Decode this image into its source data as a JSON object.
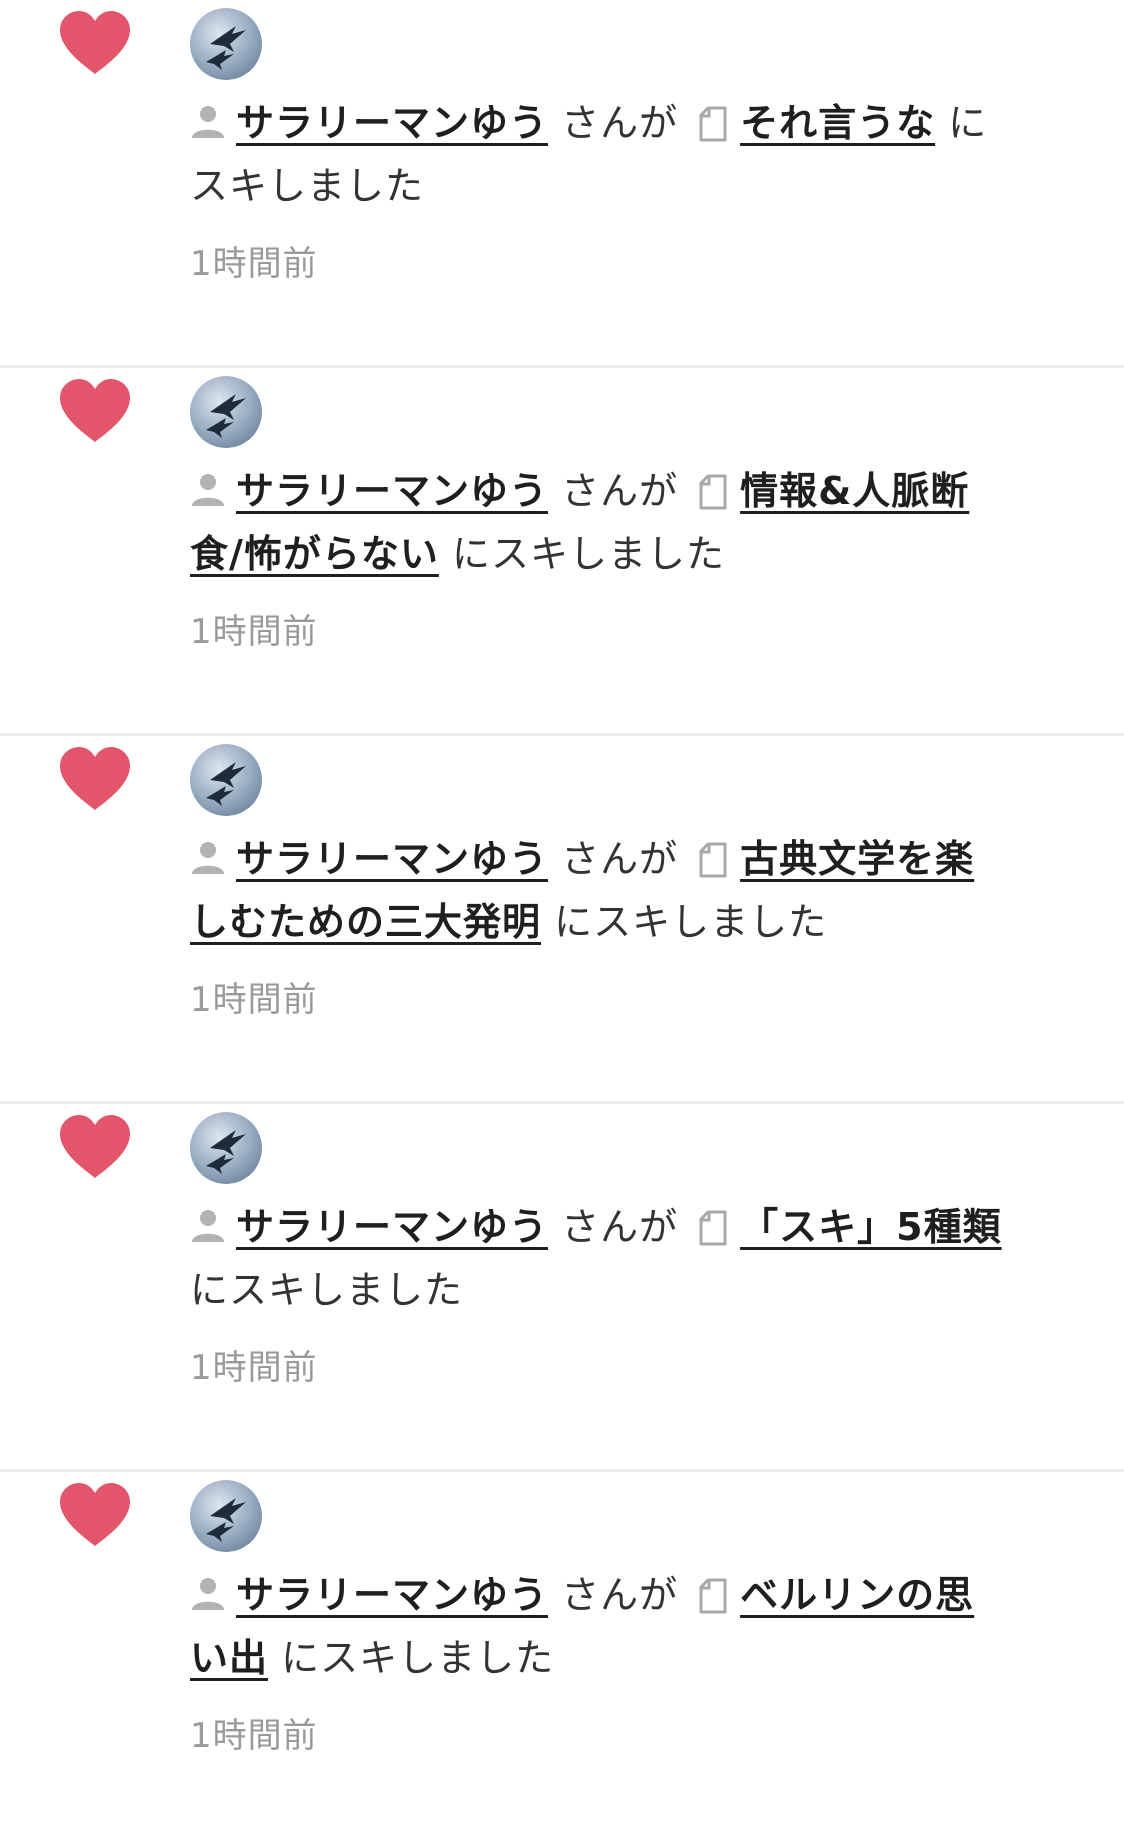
{
  "notifications": [
    {
      "user_name": "サラリーマンゆう",
      "connector": "さんが",
      "article_title": "それ言うな",
      "action": "にスキしました",
      "time": "1時間前"
    },
    {
      "user_name": "サラリーマンゆう",
      "connector": "さんが",
      "article_title": "情報&人脈断食/怖がらない",
      "action": "にスキしました",
      "time": "1時間前"
    },
    {
      "user_name": "サラリーマンゆう",
      "connector": "さんが",
      "article_title": "古典文学を楽しむための三大発明",
      "action": "にスキしました",
      "time": "1時間前"
    },
    {
      "user_name": "サラリーマンゆう",
      "connector": "さんが",
      "article_title": "「スキ」5種類",
      "action": "にスキしました",
      "time": "1時間前"
    },
    {
      "user_name": "サラリーマンゆう",
      "connector": "さんが",
      "article_title": "ベルリンの思い出",
      "action": "にスキしました",
      "time": "1時間前"
    }
  ],
  "icons": {
    "like": "heart-icon",
    "user": "user-icon",
    "article": "note-icon"
  },
  "colors": {
    "heart": "#e2556a",
    "timestamp": "#9a9a9a",
    "link": "#1f1f1f"
  }
}
